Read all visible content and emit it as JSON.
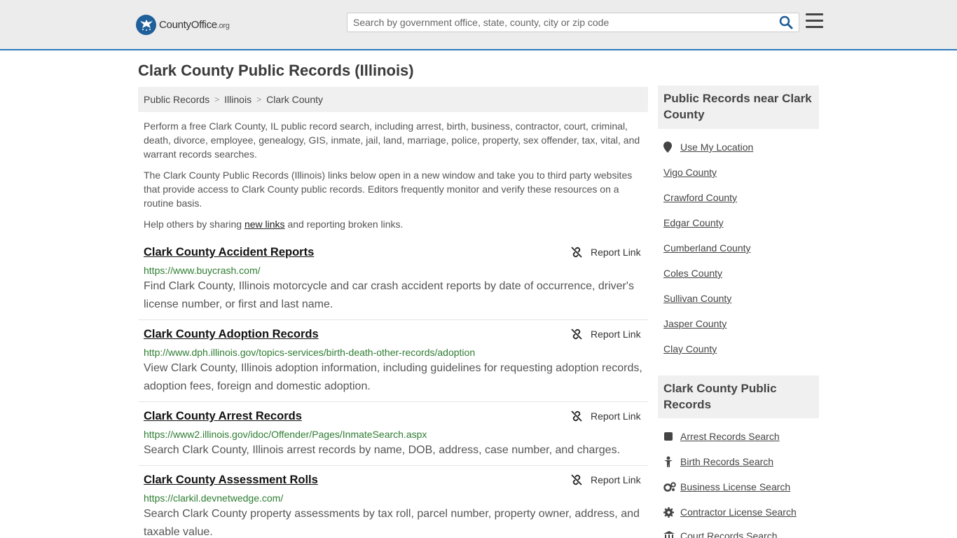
{
  "header": {
    "logo_main": "CountyOffice",
    "logo_suffix": ".org",
    "search_placeholder": "Search by government office, state, county, city or zip code"
  },
  "page_title": "Clark County Public Records (Illinois)",
  "breadcrumb": [
    "Public Records",
    "Illinois",
    "Clark County"
  ],
  "intro": {
    "p1": "Perform a free Clark County, IL public record search, including arrest, birth, business, contractor, court, criminal, death, divorce, employee, genealogy, GIS, inmate, jail, land, marriage, police, property, sex offender, tax, vital, and warrant records searches.",
    "p2": "The Clark County Public Records (Illinois) links below open in a new window and take you to third party websites that provide access to Clark County public records. Editors frequently monitor and verify these resources on a routine basis.",
    "p3_before": "Help others by sharing ",
    "p3_link": "new links",
    "p3_after": " and reporting broken links."
  },
  "report_label": "Report Link",
  "entries": [
    {
      "title": "Clark County Accident Reports",
      "url": "https://www.buycrash.com/",
      "desc": "Find Clark County, Illinois motorcycle and car crash accident reports by date of occurrence, driver's license number, or first and last name."
    },
    {
      "title": "Clark County Adoption Records",
      "url": "http://www.dph.illinois.gov/topics-services/birth-death-other-records/adoption",
      "desc": "View Clark County, Illinois adoption information, including guidelines for requesting adoption records, adoption fees, foreign and domestic adoption."
    },
    {
      "title": "Clark County Arrest Records",
      "url": "https://www2.illinois.gov/idoc/Offender/Pages/InmateSearch.aspx",
      "desc": "Search Clark County, Illinois arrest records by name, DOB, address, case number, and charges."
    },
    {
      "title": "Clark County Assessment Rolls",
      "url": "https://clarkil.devnetwedge.com/",
      "desc": "Search Clark County property assessments by tax roll, parcel number, property owner, address, and taxable value."
    }
  ],
  "sidebar": {
    "nearby_heading": "Public Records near Clark County",
    "use_location": "Use My Location",
    "nearby": [
      "Vigo County",
      "Crawford County",
      "Edgar County",
      "Cumberland County",
      "Coles County",
      "Sullivan County",
      "Jasper County",
      "Clay County"
    ],
    "records_heading": "Clark County Public Records",
    "records": [
      {
        "label": "Arrest Records Search",
        "icon": "square-icon"
      },
      {
        "label": "Birth Records Search",
        "icon": "person-icon"
      },
      {
        "label": "Business License Search",
        "icon": "gears-icon"
      },
      {
        "label": "Contractor License Search",
        "icon": "gear-icon"
      },
      {
        "label": "Court Records Search",
        "icon": "courthouse-icon"
      }
    ]
  }
}
